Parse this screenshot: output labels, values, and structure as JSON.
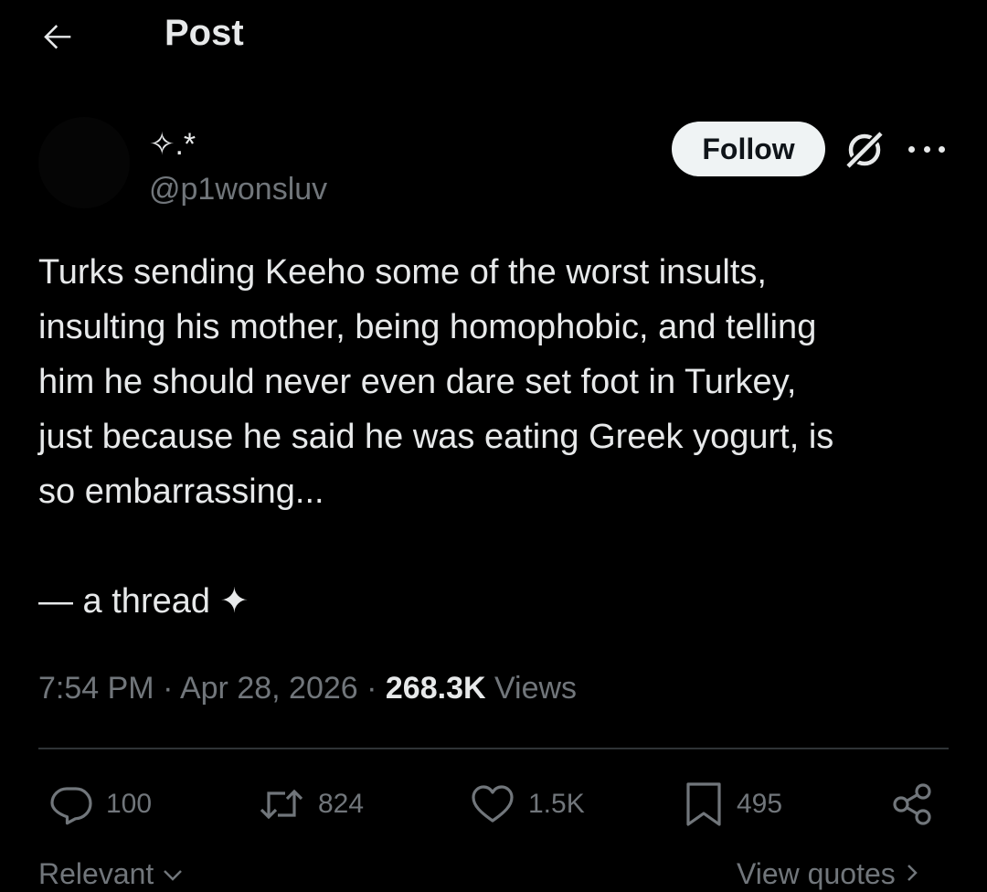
{
  "header": {
    "title": "Post",
    "back_icon": "arrow-left-icon"
  },
  "author": {
    "display_name": "✧.*",
    "handle": "@p1wonsluv"
  },
  "actions_top": {
    "follow_label": "Follow",
    "grok_icon": "grok-icon",
    "more_icon": "more-horizontal-icon"
  },
  "post": {
    "text": "Turks sending Keeho some of the worst insults,\ninsulting his mother, being homophobic, and telling\nhim he should never even dare set foot in Turkey,\njust because he said he was eating Greek yogurt, is\nso embarrassing...\n\n— a thread ✦"
  },
  "meta": {
    "time": "7:54 PM",
    "separator1": " · ",
    "date": "Apr 28, 2026",
    "separator2": " · ",
    "views_count": "268.3K",
    "views_label": " Views"
  },
  "engagement": {
    "replies": "100",
    "reposts": "824",
    "likes": "1.5K",
    "bookmarks": "495"
  },
  "footer": {
    "sort_label": "Relevant",
    "quotes_label": "View quotes"
  },
  "colors": {
    "background": "#000000",
    "text_primary": "#e7e9ea",
    "text_secondary": "#71767b",
    "divider": "#2f3336",
    "follow_bg": "#eff3f4"
  }
}
